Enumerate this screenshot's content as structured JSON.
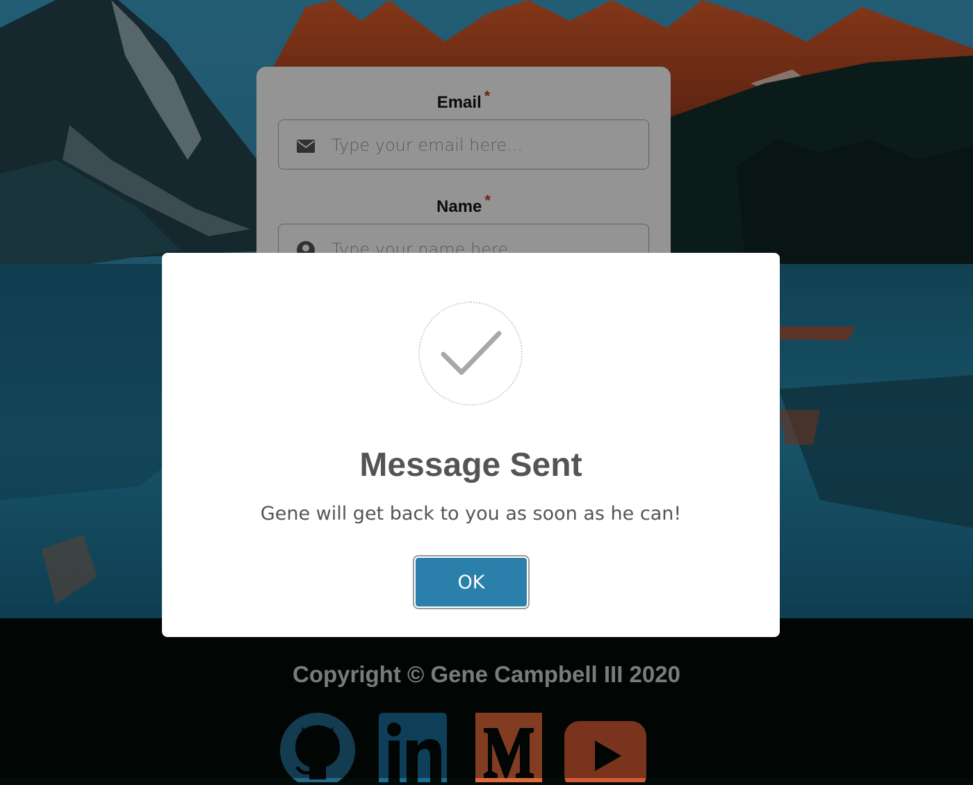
{
  "form": {
    "email_label": "Email",
    "email_required": "*",
    "email_placeholder": "Type your email here...",
    "email_icon": "envelope-icon",
    "name_label": "Name",
    "name_required": "*",
    "name_placeholder": "Type your name here...",
    "name_icon": "user-circle-icon"
  },
  "modal": {
    "icon": "checkmark-icon",
    "title": "Message Sent",
    "message": "Gene will get back to you as soon as he can!",
    "ok_label": "OK",
    "ok_color": "#2a7fab"
  },
  "footer": {
    "copyright": "Copyright © Gene Campbell III 2020",
    "social": [
      {
        "icon": "github-icon",
        "color": "#24688a"
      },
      {
        "icon": "linkedin-icon",
        "color": "#1a6b9a",
        "text": "in"
      },
      {
        "icon": "medium-icon",
        "color": "#e0683c",
        "text": "M"
      },
      {
        "icon": "youtube-icon",
        "color": "#d35a35"
      }
    ]
  }
}
